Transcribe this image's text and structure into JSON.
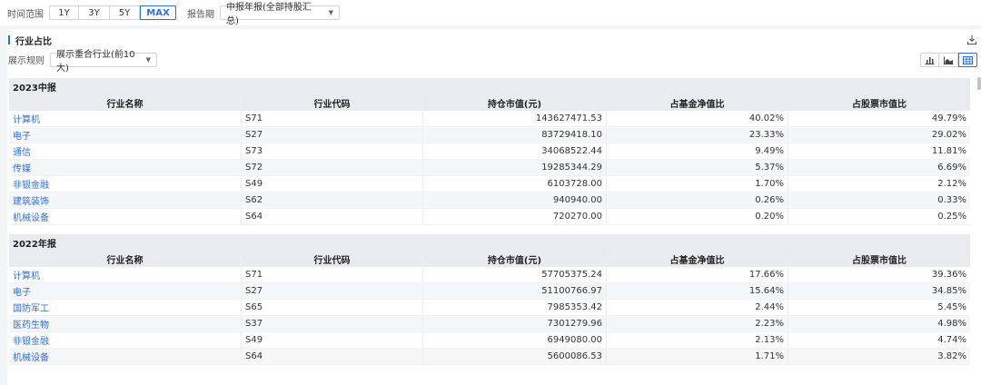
{
  "filters": {
    "time_label": "时间范围",
    "time_options": [
      "1Y",
      "3Y",
      "5Y",
      "MAX"
    ],
    "time_active": "MAX",
    "period_label": "报告期",
    "period_value": "中报年报(全部持股汇总)"
  },
  "section": {
    "title": "行业占比",
    "rule_label": "展示规则",
    "rule_value": "展示重合行业(前10大)"
  },
  "columns": [
    "行业名称",
    "行业代码",
    "持仓市值(元)",
    "占基金净值比",
    "占股票市值比"
  ],
  "tables": [
    {
      "title": "2023中报",
      "rows": [
        {
          "name": "计算机",
          "code": "S71",
          "value": "143627471.53",
          "nav": "40.02%",
          "stock": "49.79%"
        },
        {
          "name": "电子",
          "code": "S27",
          "value": "83729418.10",
          "nav": "23.33%",
          "stock": "29.02%"
        },
        {
          "name": "通信",
          "code": "S73",
          "value": "34068522.44",
          "nav": "9.49%",
          "stock": "11.81%"
        },
        {
          "name": "传媒",
          "code": "S72",
          "value": "19285344.29",
          "nav": "5.37%",
          "stock": "6.69%"
        },
        {
          "name": "非银金融",
          "code": "S49",
          "value": "6103728.00",
          "nav": "1.70%",
          "stock": "2.12%"
        },
        {
          "name": "建筑装饰",
          "code": "S62",
          "value": "940940.00",
          "nav": "0.26%",
          "stock": "0.33%"
        },
        {
          "name": "机械设备",
          "code": "S64",
          "value": "720270.00",
          "nav": "0.20%",
          "stock": "0.25%"
        }
      ]
    },
    {
      "title": "2022年报",
      "rows": [
        {
          "name": "计算机",
          "code": "S71",
          "value": "57705375.24",
          "nav": "17.66%",
          "stock": "39.36%"
        },
        {
          "name": "电子",
          "code": "S27",
          "value": "51100766.97",
          "nav": "15.64%",
          "stock": "34.85%"
        },
        {
          "name": "国防军工",
          "code": "S65",
          "value": "7985353.42",
          "nav": "2.44%",
          "stock": "5.45%"
        },
        {
          "name": "医药生物",
          "code": "S37",
          "value": "7301279.96",
          "nav": "2.23%",
          "stock": "4.98%"
        },
        {
          "name": "非银金融",
          "code": "S49",
          "value": "6949080.00",
          "nav": "2.13%",
          "stock": "4.74%"
        },
        {
          "name": "机械设备",
          "code": "S64",
          "value": "5600086.53",
          "nav": "1.71%",
          "stock": "3.82%"
        }
      ]
    }
  ],
  "icons": {
    "download": "download-icon",
    "view_bar": "bar-chart-icon",
    "view_line": "area-chart-icon",
    "view_table": "table-icon"
  },
  "colors": {
    "accent": "#2f6fe0",
    "header_bg": "#e9ebef"
  }
}
